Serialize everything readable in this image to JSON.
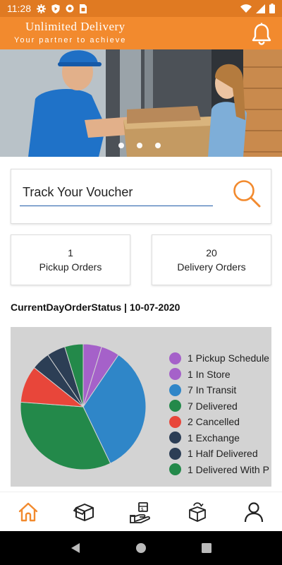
{
  "status_bar": {
    "time": "11:28"
  },
  "header": {
    "title": "Unlimited Delivery",
    "tagline": "Your partner to achieve",
    "bell_icon": "bell-icon"
  },
  "banner": {
    "slides": 3,
    "active_slide": 1
  },
  "track": {
    "placeholder": "Track Your Voucher",
    "search_icon": "search-icon"
  },
  "stats": {
    "pickup": {
      "count": "1",
      "label": "Pickup Orders"
    },
    "delivery": {
      "count": "20",
      "label": "Delivery Orders"
    }
  },
  "section_title": "CurrentDayOrderStatus | 10-07-2020",
  "chart_data": {
    "type": "pie",
    "title": "",
    "slices": [
      {
        "label": "Pickup Schedule",
        "value": 1,
        "color": "#a561c9"
      },
      {
        "label": "In Store",
        "value": 1,
        "color": "#a561c9"
      },
      {
        "label": "In Transit",
        "value": 7,
        "color": "#2f86c8"
      },
      {
        "label": "Delivered",
        "value": 7,
        "color": "#23894a"
      },
      {
        "label": "Cancelled",
        "value": 2,
        "color": "#e8463a"
      },
      {
        "label": "Exchange",
        "value": 1,
        "color": "#2c3e55"
      },
      {
        "label": "Half Delivered",
        "value": 1,
        "color": "#2c3e55"
      },
      {
        "label": "Delivered With P",
        "value": 1,
        "color": "#23894a"
      }
    ],
    "legend_placement": "right"
  },
  "legend_labels": [
    "1 Pickup Schedule",
    "1 In Store",
    "7 In Transit",
    "7 Delivered",
    "2 Cancelled",
    "1 Exchange",
    "1 Half Delivered",
    "1 Delivered With P"
  ],
  "bottom_nav": {
    "items": [
      "home-icon",
      "package-icon",
      "pickup-hand-icon",
      "return-box-icon",
      "profile-icon"
    ],
    "active_color": "#f28a2e"
  },
  "colors": {
    "brand": "#f28a2e",
    "status_bar": "#e07a22"
  }
}
